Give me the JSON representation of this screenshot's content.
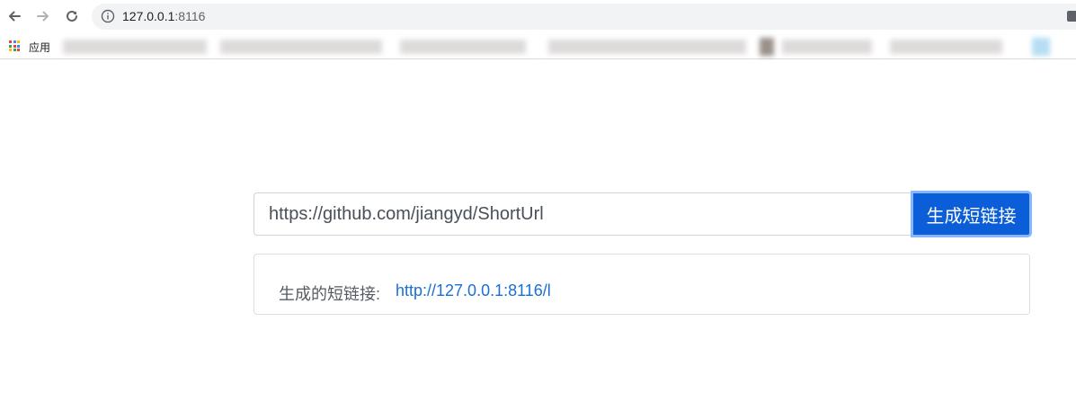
{
  "browser": {
    "url_host": "127.0.0.1",
    "url_port": ":8116",
    "bookmarks_apps_label": "应用",
    "icons": {
      "back": "back-arrow-icon",
      "forward": "forward-arrow-icon",
      "reload": "reload-icon",
      "info": "info-icon",
      "apps": "apps-grid-icon"
    }
  },
  "form": {
    "url_value": "https://github.com/jiangyd/ShortUrl",
    "submit_label": "生成短链接"
  },
  "result": {
    "label": "生成的短链接:",
    "link_text": "http://127.0.0.1:8116/l"
  },
  "colors": {
    "primary": "#0b5ed7",
    "focus_ring": "#86b7fe",
    "link": "#1a6fd6",
    "text_muted": "#555c63"
  }
}
